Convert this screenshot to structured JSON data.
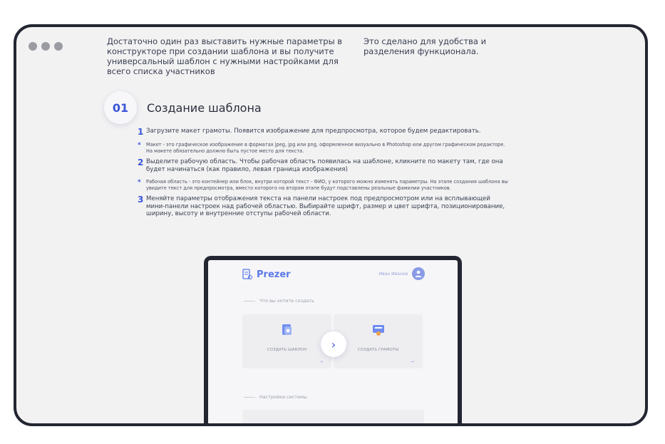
{
  "intro": {
    "left": "Достаточно один раз выставить нужные параметры в конструкторе при создании шаблона и вы получите универсальный шаблон с нужными настройками для всего списка участников",
    "right": "Это сделано для удобства и разделения функционала."
  },
  "section": {
    "number": "01",
    "title": "Создание шаблона"
  },
  "steps": [
    {
      "marker": "1",
      "text": "Загрузите макет грамоты. Появится изображение для предпросмотра, которое будем редактировать."
    },
    {
      "marker": "*",
      "text": "Макет - это графическое изображение в форматах jpeg, jpg или png, оформленное визуально в Photoshop или другом графическом редакторе. На макете обязательно должно быть пустое место для текста."
    },
    {
      "marker": "2",
      "text": "Выделите рабочую область. Чтобы рабочая область появилась на шаблоне, кликните по макету там, где она будет начинаться (как правило, левая граница изображения)"
    },
    {
      "marker": "*",
      "text": "Рабочая область - это контейнер или блок, внутри которой текст - ФИО, у которого можно изменять параметры. На этапе создания шаблона вы увидите текст для предпросмотра, вместо которого на втором этапе будут подставлены реальные фамилии участников."
    },
    {
      "marker": "3",
      "text": "Меняйте параметры отображения текста на панели настроек под предпросмотром или на всплывающей мини-панели настроек над рабочей областью. Выбирайте шрифт, размер и цвет шрифта, позиционирование, ширину, высоту и внутренние отступы рабочей области."
    }
  ],
  "app": {
    "logo": "Prezer",
    "user_name": "Иван Иванов",
    "section1": "Что вы хотите создать",
    "card1": "СОЗДАТЬ ШАБЛОН",
    "card2": "СОЗДАТЬ ГРАМОТЫ",
    "section2": "Настройки системы"
  },
  "colors": {
    "accent": "#3a55d8",
    "frame": "#232631",
    "bg": "#f2f2f3"
  }
}
